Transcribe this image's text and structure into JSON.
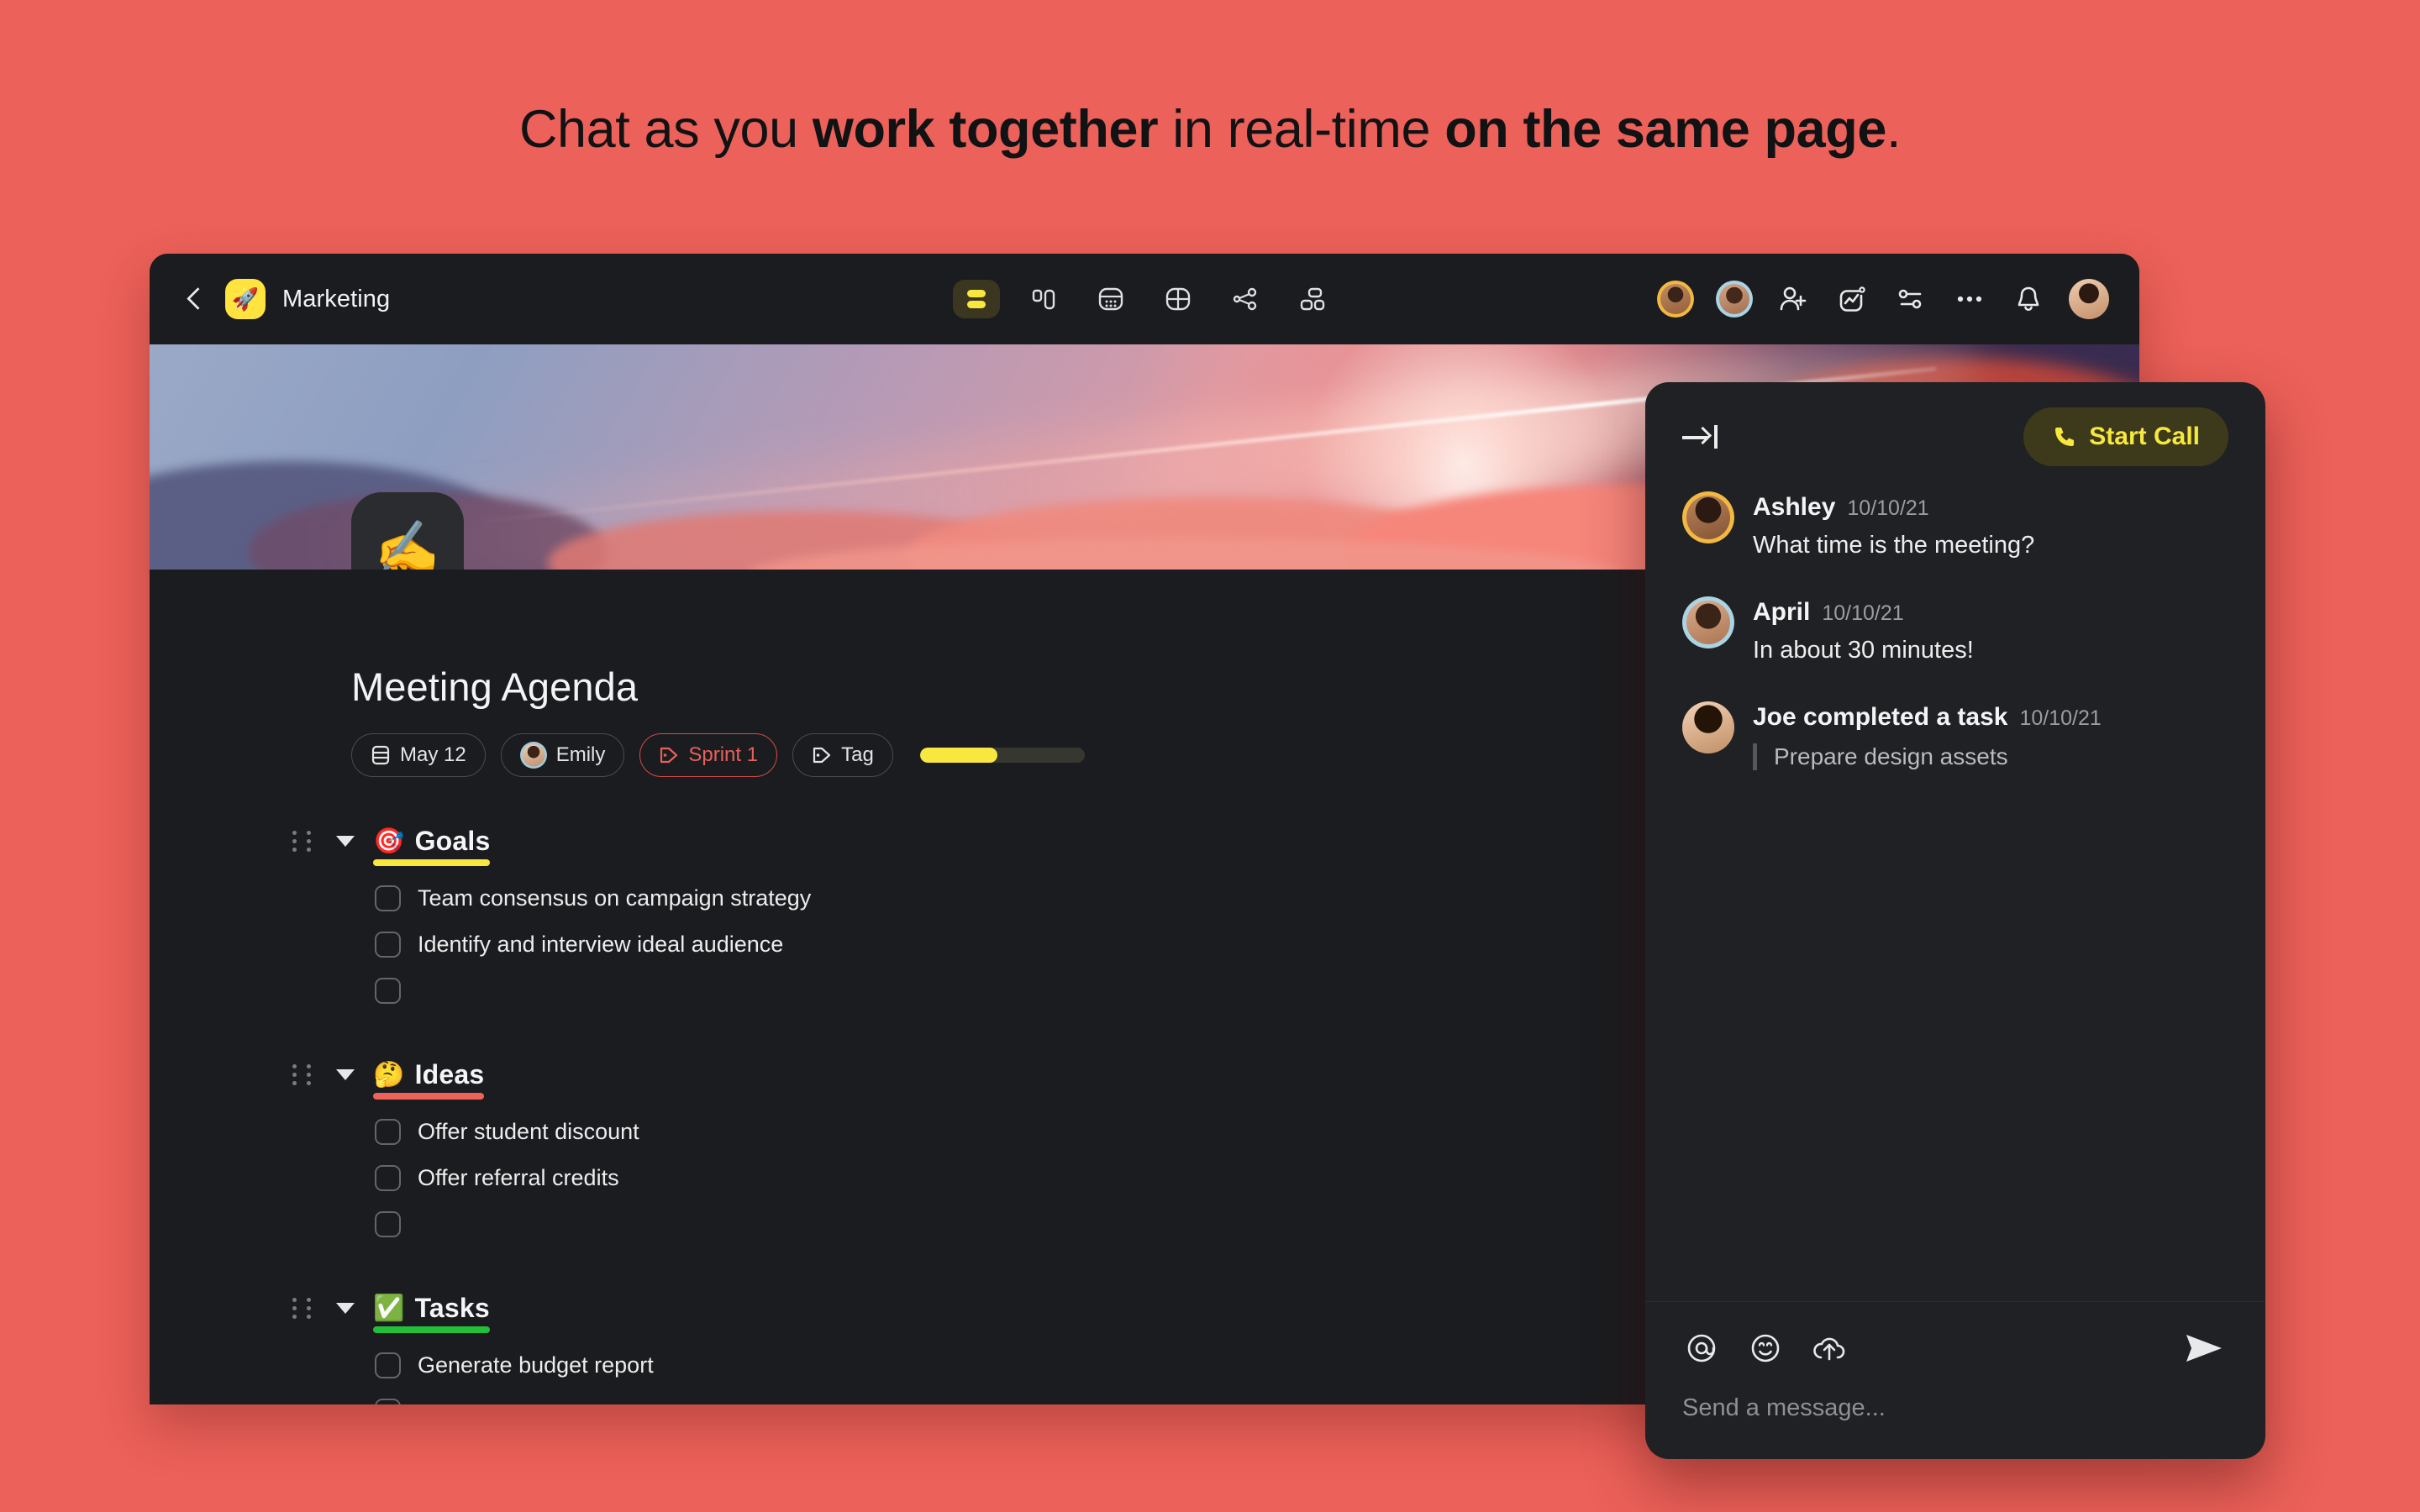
{
  "headline": {
    "part1": "Chat as you ",
    "part2": "work together",
    "part3": " in real-time ",
    "part4": "on the same page",
    "part5": "."
  },
  "colors": {
    "page_background": "#ec6159",
    "app_background": "#1b1c1f",
    "chat_background": "#202124",
    "accent_yellow": "#f7e73f",
    "accent_red": "#e8605b",
    "accent_green": "#22c03a"
  },
  "header": {
    "back_icon": "chevron-left-icon",
    "space_emoji": "🚀",
    "space_name": "Marketing",
    "views": [
      {
        "name": "list-view",
        "icon": "list-view-icon",
        "active": true
      },
      {
        "name": "board-view",
        "icon": "board-view-icon",
        "active": false
      },
      {
        "name": "calendar-view",
        "icon": "calendar-view-icon",
        "active": false
      },
      {
        "name": "grid-view",
        "icon": "grid-view-icon",
        "active": false
      },
      {
        "name": "share-view",
        "icon": "share-graph-icon",
        "active": false
      },
      {
        "name": "org-view",
        "icon": "org-chart-icon",
        "active": false
      }
    ],
    "actions": [
      {
        "name": "collaborator-avatar-1",
        "type": "avatar"
      },
      {
        "name": "collaborator-avatar-2",
        "type": "avatar"
      },
      {
        "name": "add-person",
        "icon": "add-person-icon"
      },
      {
        "name": "activity",
        "icon": "activity-chart-icon"
      },
      {
        "name": "settings",
        "icon": "sliders-icon"
      },
      {
        "name": "more",
        "icon": "more-dots-icon"
      },
      {
        "name": "notifications",
        "icon": "bell-icon"
      },
      {
        "name": "profile",
        "type": "avatar"
      }
    ]
  },
  "document": {
    "emoji": "✍️",
    "title": "Meeting Agenda",
    "chips": [
      {
        "icon": "calendar-icon",
        "label": "May 12",
        "style": "default"
      },
      {
        "icon": "avatar",
        "label": "Emily",
        "style": "default"
      },
      {
        "icon": "tag-icon",
        "label": "Sprint 1",
        "style": "red"
      },
      {
        "icon": "tag-icon",
        "label": "Tag",
        "style": "default"
      }
    ],
    "progress_percent": 47,
    "sections": [
      {
        "emoji": "🎯",
        "title": "Goals",
        "underline_color": "#f7e73f",
        "tasks": [
          {
            "label": "Team consensus on campaign strategy",
            "checked": false
          },
          {
            "label": "Identify and interview ideal audience",
            "checked": false
          },
          {
            "label": "",
            "checked": false
          }
        ]
      },
      {
        "emoji": "🤔",
        "title": "Ideas",
        "underline_color": "#ef6159",
        "tasks": [
          {
            "label": "Offer student discount",
            "checked": false
          },
          {
            "label": "Offer referral credits",
            "checked": false
          },
          {
            "label": "",
            "checked": false
          }
        ]
      },
      {
        "emoji": "✅",
        "title": "Tasks",
        "underline_color": "#22c03a",
        "tasks": [
          {
            "label": "Generate budget report",
            "checked": false
          },
          {
            "label": "",
            "checked": false
          }
        ]
      }
    ]
  },
  "chat": {
    "collapse_icon": "collapse-panel-icon",
    "start_call_label": "Start Call",
    "start_call_icon": "phone-icon",
    "messages": [
      {
        "author": "Ashley",
        "time": "10/10/21",
        "text": "What time is the meeting?",
        "quote": "",
        "avatar_ring": "yellow"
      },
      {
        "author": "April",
        "time": "10/10/21",
        "text": "In about 30 minutes!",
        "quote": "",
        "avatar_ring": "blue"
      },
      {
        "author": "Joe completed a task",
        "time": "10/10/21",
        "text": "",
        "quote": "Prepare design assets",
        "avatar_ring": "none"
      }
    ],
    "composer": {
      "placeholder": "Send a message...",
      "icons": [
        {
          "name": "mention-icon",
          "glyph": "@"
        },
        {
          "name": "emoji-icon",
          "glyph": "smiley"
        },
        {
          "name": "upload-icon",
          "glyph": "upload-cloud"
        }
      ],
      "send_icon": "send-icon"
    }
  }
}
